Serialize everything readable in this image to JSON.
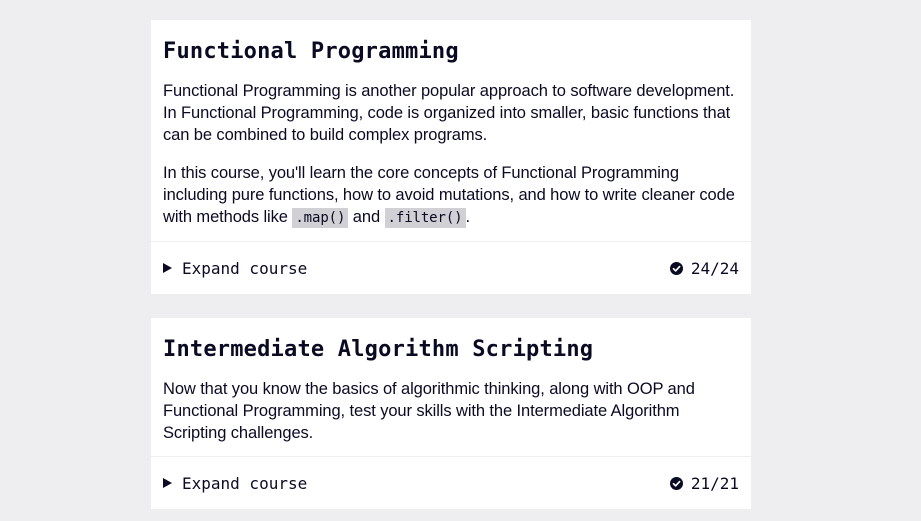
{
  "courses": [
    {
      "title": "Functional Programming",
      "paragraphs": [
        "Functional Programming is another popular approach to software development. In Functional Programming, code is organized into smaller, basic functions that can be combined to build complex programs."
      ],
      "paragraph2": {
        "before": "In this course, you'll learn the core concepts of Functional Programming including pure functions, how to avoid mutations, and how to write cleaner code with methods like ",
        "code1": ".map()",
        "between": " and ",
        "code2": ".filter()",
        "after": "."
      },
      "expand_label": "Expand course",
      "progress": "24/24"
    },
    {
      "title": "Intermediate Algorithm Scripting",
      "paragraphs": [
        "Now that you know the basics of algorithmic thinking, along with OOP and Functional Programming, test your skills with the Intermediate Algorithm Scripting challenges."
      ],
      "expand_label": "Expand course",
      "progress": "21/21"
    }
  ],
  "colors": {
    "page_background": "#eeeef0",
    "card_background": "#ffffff",
    "text": "#0a0a23",
    "code_background": "#d0d0d5"
  }
}
